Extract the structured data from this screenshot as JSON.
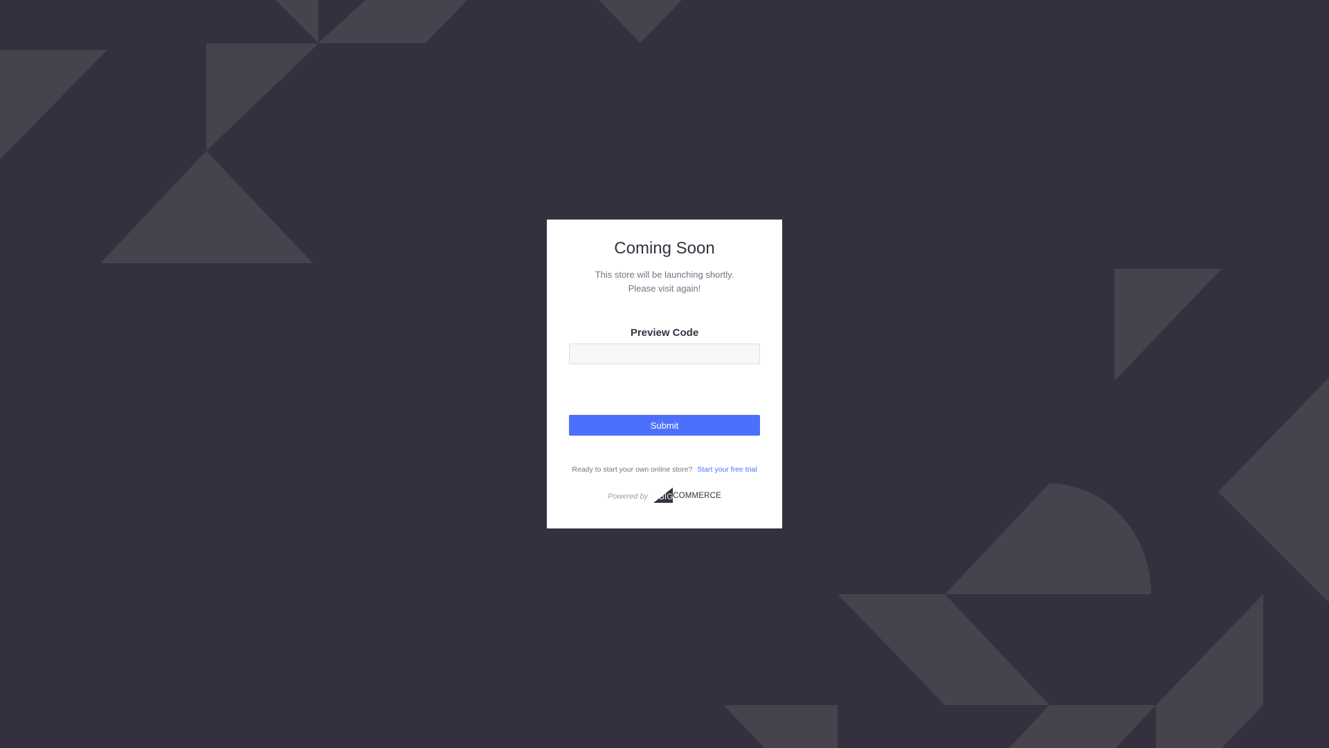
{
  "page": {
    "background_color": "#34313f",
    "shape_color": "#46434f"
  },
  "card": {
    "title": "Coming Soon",
    "subtitle_line1": "This store will be launching shortly.",
    "subtitle_line2": "Please visit again!",
    "preview_code_label": "Preview Code",
    "preview_code_value": "",
    "submit_label": "Submit",
    "trial_prompt": "Ready to start your own online store?",
    "trial_link": "Start your free trial",
    "powered_by": "Powered by",
    "logo_text_big": "BIG",
    "logo_text_commerce": "COMMERCE",
    "accent_color": "#4b71fc"
  }
}
